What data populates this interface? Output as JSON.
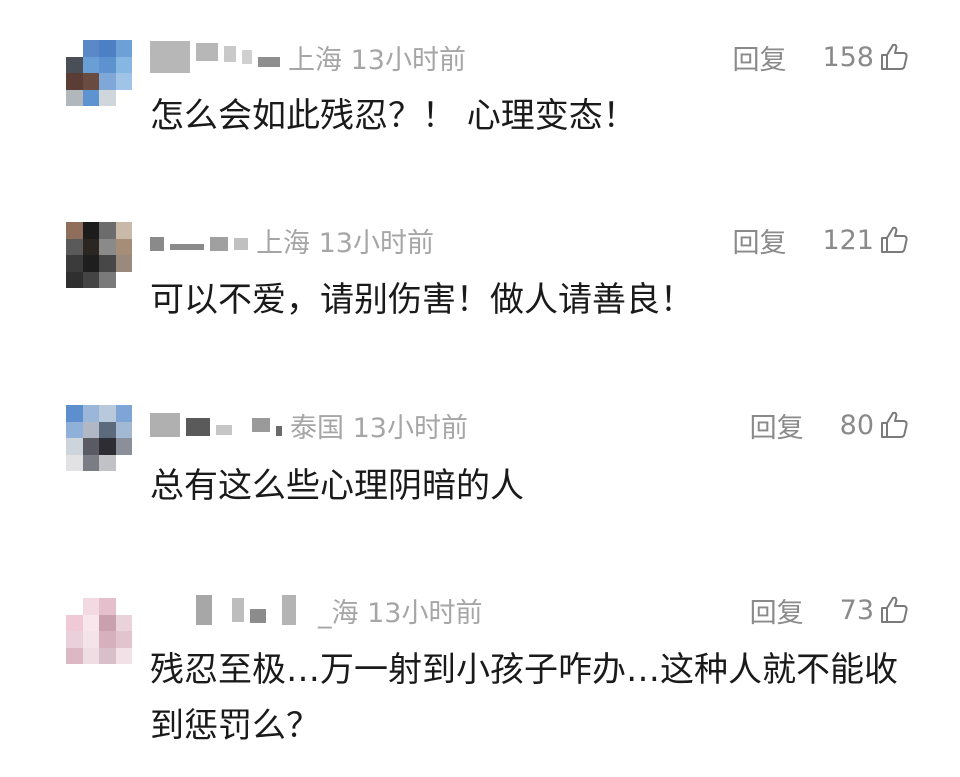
{
  "comments": [
    {
      "location_time": "上海 13小时前",
      "reply_label": "回复",
      "likes": "158",
      "text": "怎么会如此残忍？！ 心理变态！",
      "avatar_colors": [
        "#ffffff",
        "#5a88c8",
        "#4d7fc5",
        "#6da0d6",
        "#4a4f57",
        "#6a9fd6",
        "#5d92d0",
        "#86b6e2",
        "#5a3d35",
        "#6a4b3f",
        "#7fa8d8",
        "#9fc4e8",
        "#b2b7bc",
        "#5c93d0",
        "#cfd6dc",
        "#ffffff"
      ]
    },
    {
      "location_time": "上海 13小时前",
      "reply_label": "回复",
      "likes": "121",
      "text": "可以不爱，请别伤害！做人请善良！",
      "avatar_colors": [
        "#8f6e5c",
        "#1c1c1c",
        "#6c6c6c",
        "#c9b9a8",
        "#5a5a5a",
        "#2c2623",
        "#8a8a8a",
        "#a58d78",
        "#3b3b3b",
        "#1e1e1e",
        "#474747",
        "#9a8a7c",
        "#2f2f2f",
        "#444444",
        "#7a7a7a",
        "#ffffff"
      ]
    },
    {
      "location_time": "泰国 13小时前",
      "reply_label": "回复",
      "likes": "80",
      "text": "总有这么些心理阴暗的人",
      "avatar_colors": [
        "#5d8fcf",
        "#9ab6d8",
        "#b9c9dc",
        "#7ea5d5",
        "#8fb0d8",
        "#b0b8c6",
        "#5c6a7d",
        "#a3b8d2",
        "#cdd4dc",
        "#5a5a63",
        "#2d2d33",
        "#8a8f99",
        "#e2e2e4",
        "#7b7d84",
        "#c0c2c6",
        "#ffffff"
      ]
    },
    {
      "location_time": "_海 13小时前",
      "reply_label": "回复",
      "likes": "73",
      "text": "残忍至极…万一射到小孩子咋办…这种人就不能收到惩罚么？",
      "avatar_colors": [
        "#ffffff",
        "#f3d9e2",
        "#e6bfcd",
        "#ffffff",
        "#f0c9d6",
        "#f8e6ec",
        "#c9a0ae",
        "#ead2da",
        "#ead0da",
        "#f4e3e9",
        "#d7b0bd",
        "#e2c4cf",
        "#dcb8c4",
        "#efdde4",
        "#d9bfc9",
        "#f2e2e8"
      ]
    }
  ]
}
